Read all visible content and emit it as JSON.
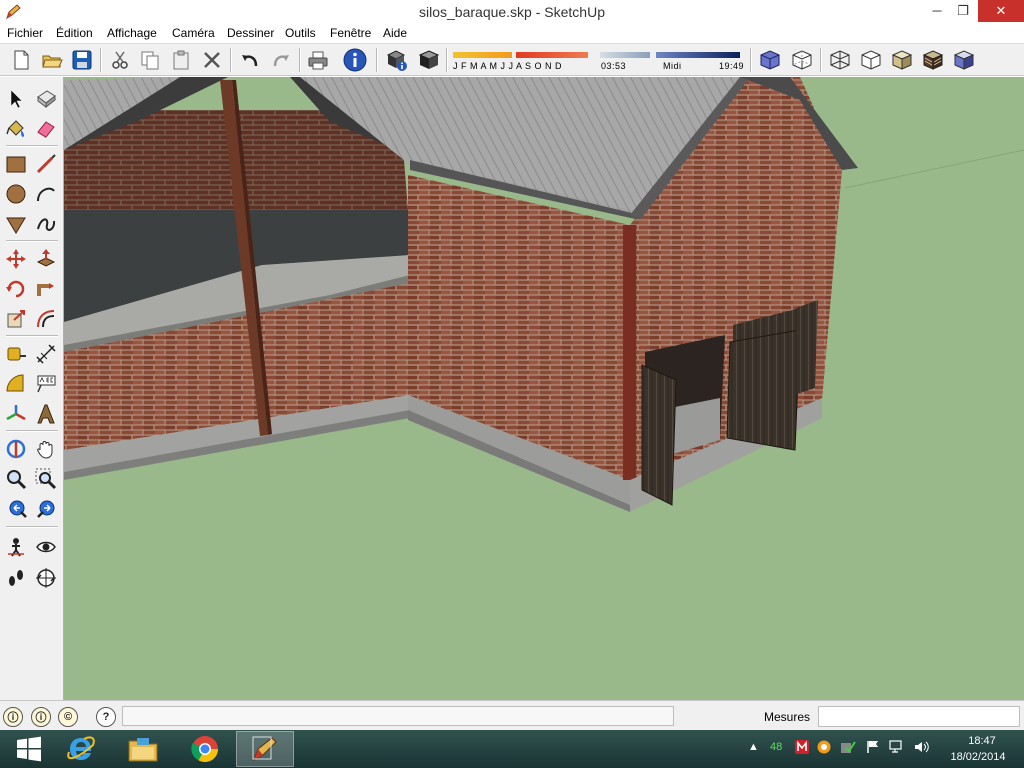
{
  "window": {
    "title": "silos_baraque.skp - SketchUp",
    "minimize_glyph": "─",
    "restore_glyph": "❐",
    "close_glyph": "✕"
  },
  "menu": {
    "items": [
      "Fichier",
      "Édition",
      "Affichage",
      "Caméra",
      "Dessiner",
      "Outils",
      "Fenêtre",
      "Aide"
    ]
  },
  "toolbar": {
    "shadow_months": "J F M A M J J A S O N D",
    "shadow_time_start": "03:53",
    "shadow_time_mid": "Midi",
    "shadow_time_end": "19:49",
    "icons": [
      "new-icon",
      "open-icon",
      "save-icon",
      "cut-icon",
      "copy-icon",
      "paste-icon",
      "erase-icon",
      "undo-icon",
      "redo-icon",
      "print-icon",
      "model-info-icon",
      "components-icon",
      "material-icon",
      "xray-icon",
      "back-edges-icon",
      "wireframe-icon",
      "hidden-line-icon",
      "shaded-icon",
      "shaded-textures-icon",
      "monochrome-icon"
    ]
  },
  "palette": {
    "tools": [
      "select-icon",
      "make-component-icon",
      "paint-bucket-icon",
      "eraser-icon",
      "rectangle-icon",
      "line-icon",
      "circle-icon",
      "arc-icon",
      "polygon-icon",
      "freehand-icon",
      "move-icon",
      "push-pull-icon",
      "rotate-icon",
      "follow-me-icon",
      "scale-icon",
      "offset-icon",
      "tape-measure-icon",
      "dimension-icon",
      "protractor-icon",
      "text-icon",
      "axes-icon",
      "3d-text-icon",
      "orbit-icon",
      "pan-icon",
      "zoom-icon",
      "zoom-window-icon",
      "previous-view-icon",
      "next-view-icon",
      "position-camera-icon",
      "look-around-icon",
      "walk-icon",
      "section-plane-icon"
    ]
  },
  "status": {
    "measurements_label": "Mesures",
    "measurements_value": "",
    "help_glyph": "?"
  },
  "taskbar": {
    "apps": [
      "windows-start-icon",
      "internet-explorer-icon",
      "file-explorer-icon",
      "chrome-icon",
      "sketchup-icon"
    ],
    "tray_count": "48",
    "time": "18:47",
    "date": "18/02/2014"
  },
  "colors": {
    "ground": "#99b98a",
    "brick": "#8a4a36",
    "roof": "#a8a8a8",
    "concrete": "#8e8e8e",
    "door": "#3b332b",
    "close_button": "#c7302b"
  }
}
